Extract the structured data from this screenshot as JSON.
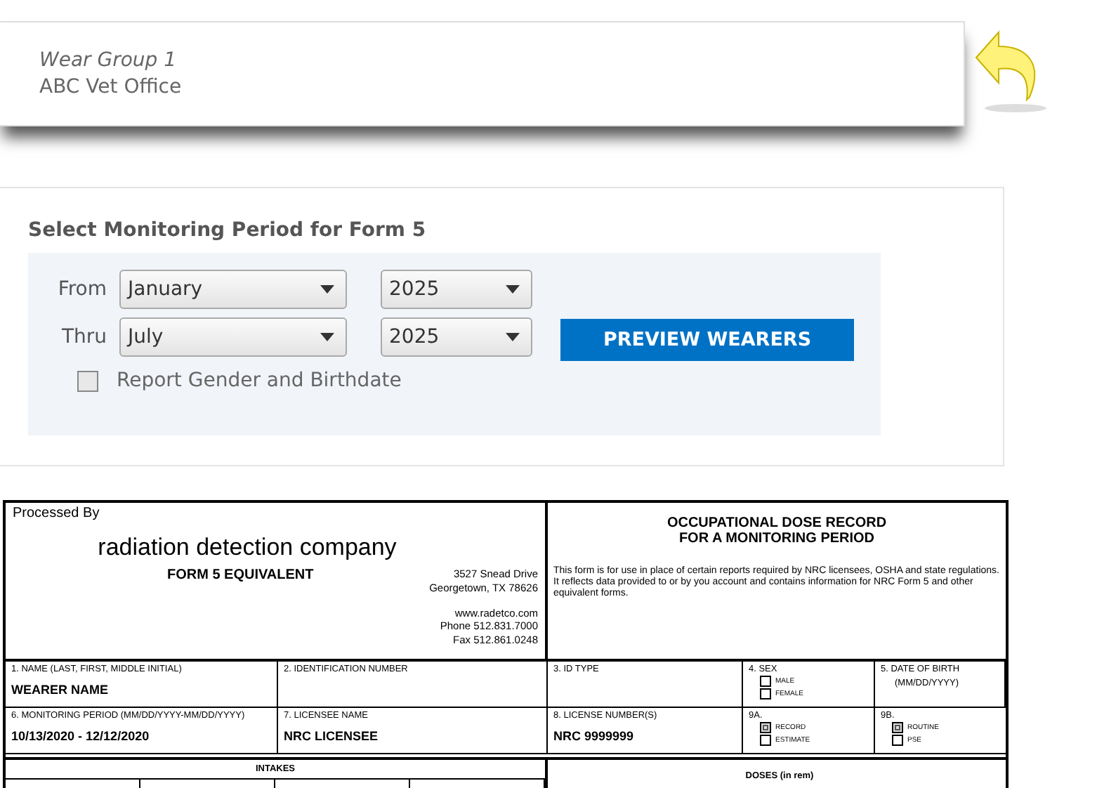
{
  "header": {
    "group": "Wear Group 1",
    "office": "ABC Vet Office"
  },
  "period_form": {
    "title": "Select Monitoring Period for Form 5",
    "rows": [
      {
        "label": "From",
        "month": "January",
        "year": "2025"
      },
      {
        "label": "Thru",
        "month": "July",
        "year": "2025"
      }
    ],
    "button": "PREVIEW WEARERS",
    "option": {
      "label": "Report Gender and Birthdate",
      "checked": false
    }
  },
  "form5": {
    "processed_by": "Processed By",
    "company": "radiation detection company",
    "subtitle": "FORM 5 EQUIVALENT",
    "address": [
      "3527 Snead Drive",
      "Georgetown, TX 78626"
    ],
    "contact": [
      "www.radetco.com",
      "Phone 512.831.7000",
      "Fax 512.861.0248"
    ],
    "title": [
      "OCCUPATIONAL DOSE RECORD",
      "FOR A MONITORING PERIOD"
    ],
    "description": "This form is for use in place of certain reports required by NRC licensees, OSHA and state regulations. It reflects data provided to or by you account and contains information for NRC Form 5 and other equivalent forms.",
    "rows": [
      [
        {
          "kind": "text",
          "label": "1. NAME (LAST, FIRST, MIDDLE INITIAL)",
          "value": "WEARER NAME"
        },
        {
          "kind": "text",
          "label": "2. IDENTIFICATION NUMBER"
        },
        {
          "kind": "text",
          "label": "3. ID TYPE"
        },
        {
          "kind": "checks",
          "label": "4. SEX",
          "options": [
            {
              "label": "MALE",
              "checked": false
            },
            {
              "label": "FEMALE",
              "checked": false
            }
          ]
        },
        {
          "kind": "hint",
          "label": "5. DATE OF BIRTH",
          "hint": "(MM/DD/YYYY)"
        }
      ],
      [
        {
          "kind": "text",
          "label": "6. MONITORING PERIOD (MM/DD/YYYY-MM/DD/YYYY)",
          "value": "10/13/2020 - 12/12/2020"
        },
        {
          "kind": "text",
          "label": "7. LICENSEE NAME",
          "value": "NRC LICENSEE"
        },
        {
          "kind": "text",
          "label": "8. LICENSE NUMBER(S)",
          "value": "NRC 9999999"
        },
        {
          "kind": "checks",
          "label": "9A.",
          "options": [
            {
              "label": "RECORD",
              "checked": true
            },
            {
              "label": "ESTIMATE",
              "checked": false
            }
          ]
        },
        {
          "kind": "checks",
          "label": "9B.",
          "options": [
            {
              "label": "ROUTINE",
              "checked": true
            },
            {
              "label": "PSE",
              "checked": false
            }
          ]
        }
      ]
    ],
    "intakes": "INTAKES",
    "doses": "DOSES (in rem)"
  }
}
